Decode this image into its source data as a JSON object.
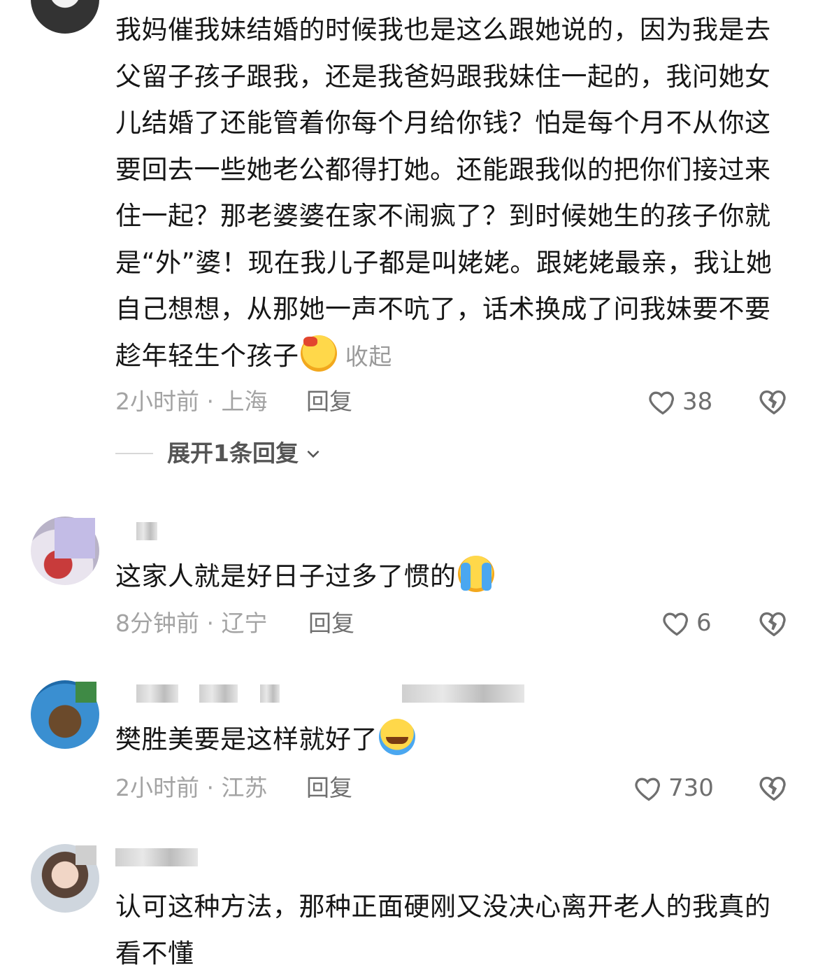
{
  "comments": [
    {
      "text": "我妈催我妹结婚的时候我也是这么跟她说的，因为我是去父留子孩子跟我，还是我爸妈跟我妹住一起的，我问她女儿结婚了还能管着你每个月给你钱？怕是每个月不从你这要回去一些她老公都得打她。还能跟我似的把你们接过来住一起？那老婆婆在家不闹疯了？到时候她生的孩子你就是“外”婆！现在我儿子都是叫姥姥。跟姥姥最亲，我让她自己想想，从那她一声不吭了，话术换成了问我妹要不要趁年轻生个孩子",
      "collapse_label": "收起",
      "emoji": "smirk-emoji",
      "time_location": "2小时前 · 上海",
      "reply_label": "回复",
      "likes": "38",
      "expand_label": "展开1条回复"
    },
    {
      "text": "这家人就是好日子过多了惯的",
      "emoji": "laugh-cry-emoji",
      "time_location": "8分钟前 · 辽宁",
      "reply_label": "回复",
      "likes": "6"
    },
    {
      "text": "樊胜美要是这样就好了",
      "emoji": "crying-emoji",
      "time_location": "2小时前 · 江苏",
      "reply_label": "回复",
      "likes": "730"
    },
    {
      "text": "认可这种方法，那种正面硬刚又没决心离开老人的我真的看不懂"
    }
  ],
  "colors": {
    "text": "#161616",
    "meta": "#a3a3a3",
    "reply": "#6f6f6f",
    "background": "#ffffff"
  }
}
